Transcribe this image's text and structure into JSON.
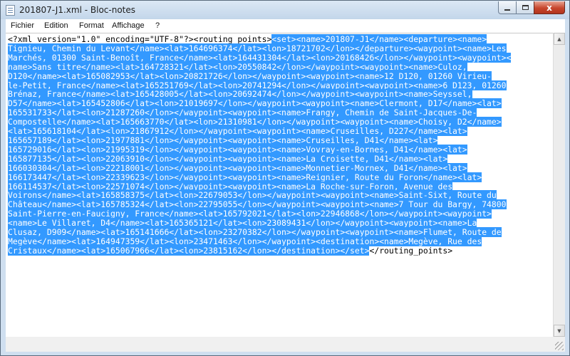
{
  "window": {
    "title": "201807-J1.xml - Bloc-notes",
    "buttons": {
      "close": "x"
    }
  },
  "menu": [
    "Fichier",
    "Edition",
    "Format",
    "Affichage",
    "?"
  ],
  "editor": {
    "lines": [
      {
        "pre": "<?xml version=\"1.0\" encoding=\"UTF-8\"?><routing_points>",
        "sel": "<set><name>201807-J1</name><departure><name>",
        "post": ""
      },
      {
        "pre": "",
        "sel": "Tignieu, Chemin du Levant</name><lat>164696374</lat><lon>18721702</lon></departure><waypoint><name>Les",
        "post": ""
      },
      {
        "pre": "",
        "sel": "Marchés, 01300 Saint-Benoît, France</name><lat>164431304</lat><lon>20168426</lon></waypoint><waypoint><",
        "post": ""
      },
      {
        "pre": "",
        "sel": "name>Sans titre</name><lat>164728321</lat><lon>20550842</lon></waypoint><waypoint><name>Culoz,",
        "post": ""
      },
      {
        "pre": "",
        "sel": "D120</name><lat>165082953</lat><lon>20821726</lon></waypoint><waypoint><name>12 D120, 01260 Virieu-",
        "post": ""
      },
      {
        "pre": "",
        "sel": "le-Petit, France</name><lat>165251769</lat><lon>20741294</lon></waypoint><waypoint><name>6 D123, 01260",
        "post": ""
      },
      {
        "pre": "",
        "sel": "Brénaz, France</name><lat>165428005</lat><lon>20692474</lon></waypoint><waypoint><name>Seyssel,",
        "post": ""
      },
      {
        "pre": "",
        "sel": "D57</name><lat>165452806</lat><lon>21019697</lon></waypoint><waypoint><name>Clermont, D17</name><lat>",
        "post": ""
      },
      {
        "pre": "",
        "sel": "165531733</lat><lon>21287260</lon></waypoint><waypoint><name>Frangy, Chemin de Saint-Jacques-De-",
        "post": ""
      },
      {
        "pre": "",
        "sel": "Compostelle</name><lat>165663770</lat><lon>21310981</lon></waypoint><waypoint><name>Choisy, D2</name>",
        "post": ""
      },
      {
        "pre": "",
        "sel": "<lat>165618104</lat><lon>21867912</lon></waypoint><waypoint><name>Cruseilles, D227</name><lat>",
        "post": ""
      },
      {
        "pre": "",
        "sel": "165657189</lat><lon>21977881</lon></waypoint><waypoint><name>Cruseilles, D41</name><lat>",
        "post": ""
      },
      {
        "pre": "",
        "sel": "165729016</lat><lon>21995319</lon></waypoint><waypoint><name>Vovray-en-Bornes, D41</name><lat>",
        "post": ""
      },
      {
        "pre": "",
        "sel": "165877135</lat><lon>22063910</lon></waypoint><waypoint><name>La Croisette, D41</name><lat>",
        "post": ""
      },
      {
        "pre": "",
        "sel": "166030304</lat><lon>22218001</lon></waypoint><waypoint><name>Monnetier-Mornex, D41</name><lat>",
        "post": ""
      },
      {
        "pre": "",
        "sel": "166173447</lat><lon>22339623</lon></waypoint><waypoint><name>Reignier, Route du Foron</name><lat>",
        "post": ""
      },
      {
        "pre": "",
        "sel": "166114537</lat><lon>22571074</lon></waypoint><waypoint><name>La Roche-sur-Foron, Avenue des",
        "post": ""
      },
      {
        "pre": "",
        "sel": "Voirons</name><lat>165858375</lat><lon>22679053</lon></waypoint><waypoint><name>Saint-Sixt, Route du",
        "post": ""
      },
      {
        "pre": "",
        "sel": "Château</name><lat>165785324</lat><lon>22795055</lon></waypoint><waypoint><name>7 Tour du Bargy, 74800",
        "post": ""
      },
      {
        "pre": "",
        "sel": "Saint-Pierre-en-Faucigny, France</name><lat>165792021</lat><lon>22946868</lon></waypoint><waypoint>",
        "post": ""
      },
      {
        "pre": "",
        "sel": "<name>Le Villaret, D4</name><lat>165365121</lat><lon>23089431</lon></waypoint><waypoint><name>La",
        "post": ""
      },
      {
        "pre": "",
        "sel": "Clusaz, D909</name><lat>165141666</lat><lon>23270382</lon></waypoint><waypoint><name>Flumet, Route de",
        "post": ""
      },
      {
        "pre": "",
        "sel": "Megève</name><lat>164947359</lat><lon>23471463</lon></waypoint><destination><name>Megève, Rue des",
        "post": ""
      },
      {
        "pre": "",
        "sel": "Cristaux</name><lat>165067966</lat><lon>23815162</lon></destination></set>",
        "post": "</routing_points>"
      }
    ]
  },
  "colors": {
    "selection": "#3399ff",
    "close_button": "#c7462d",
    "frame": "#cfdff0"
  }
}
